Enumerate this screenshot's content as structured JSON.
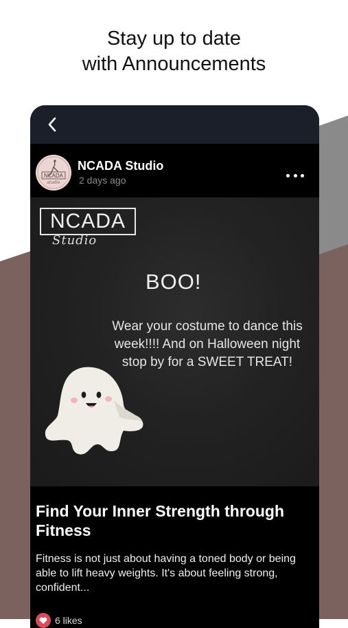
{
  "headline": {
    "line1": "Stay up to date",
    "line2": "with Announcements"
  },
  "post": {
    "author": "NCADA Studio",
    "time": "2 days ago",
    "image": {
      "logo_text": "NCADA",
      "logo_script": "Studio",
      "boo": "BOO!",
      "message": "Wear your costume to dance this week!!!! And on Halloween night stop by for a SWEET TREAT!"
    },
    "title": "Find Your Inner Strength through Fitness",
    "excerpt": "Fitness is not just about having a toned body or being able to lift heavy weights. It's about feeling strong, confident...",
    "likes": "6 likes"
  },
  "colors": {
    "topbar": "#1b1f29",
    "background_mauve": "#7b625f",
    "background_grey": "#8a8a8a",
    "like_heart": "#d94c5b"
  },
  "icons": [
    "back-chevron-icon",
    "more-dots-icon",
    "heart-icon",
    "ghost-illustration",
    "ncada-logo"
  ]
}
